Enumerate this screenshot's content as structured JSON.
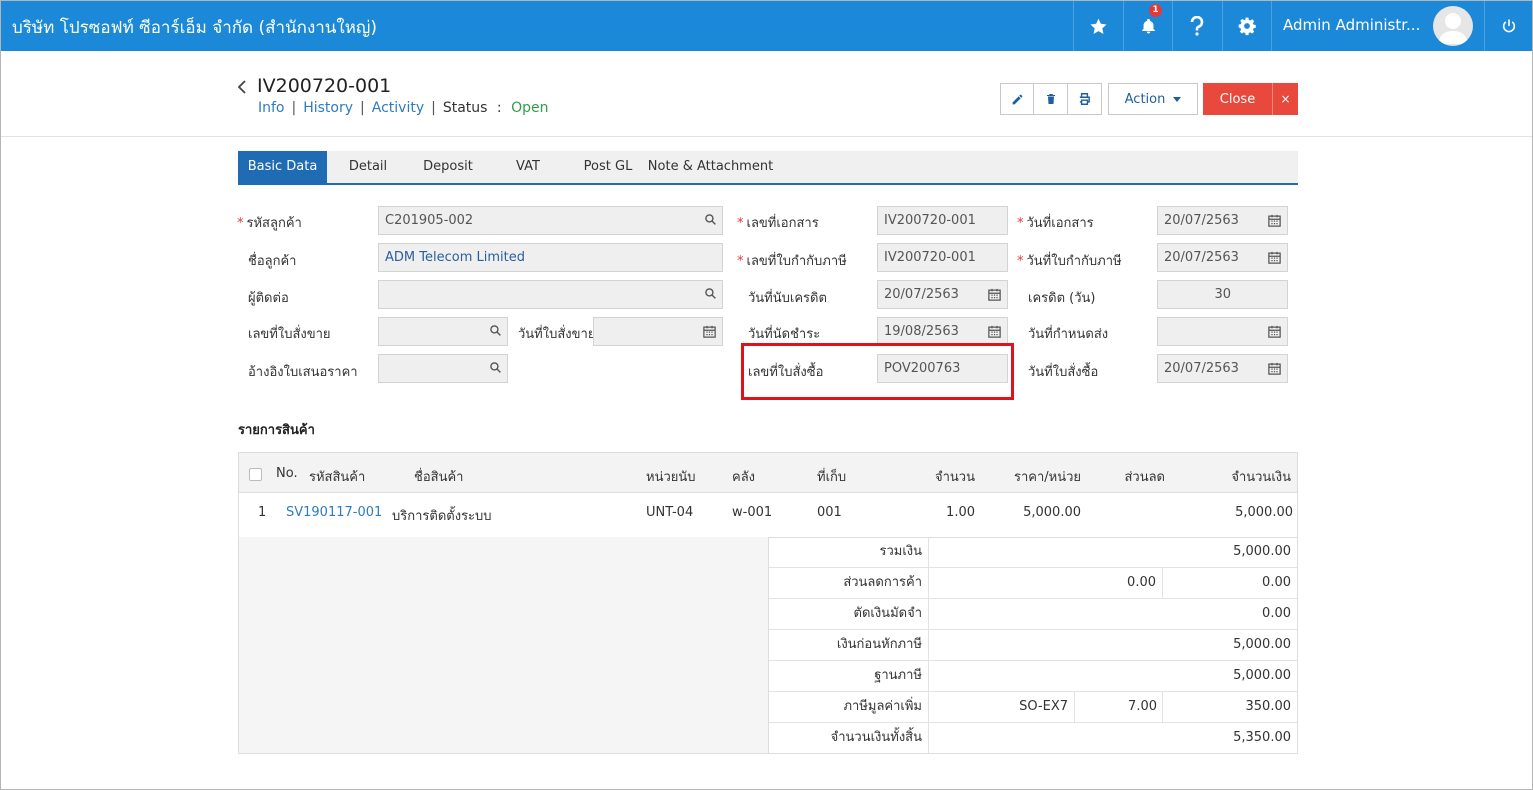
{
  "header": {
    "company": "บริษัท โปรซอฟท์ ซีอาร์เอ็ม จำกัด (สำนักงานใหญ่)",
    "notification_count": "1",
    "user_name": "Admin Administr...",
    "icons": [
      "star-icon",
      "bell-icon",
      "help-icon",
      "gear-icon",
      "avatar",
      "power-icon"
    ]
  },
  "document": {
    "number": "IV200720-001",
    "nav": {
      "info": "Info",
      "history": "History",
      "activity": "Activity",
      "status_label": "Status",
      "status_colon": ":",
      "status_value": "Open"
    },
    "buttons": {
      "action": "Action",
      "close": "Close",
      "close_x": "×"
    }
  },
  "tabs": [
    "Basic Data",
    "Detail",
    "Deposit",
    "VAT",
    "Post GL",
    "Note & Attachment"
  ],
  "form": {
    "customer_code": {
      "label": "รหัสลูกค้า",
      "value": "C201905-002"
    },
    "customer_name": {
      "label": "ชื่อลูกค้า",
      "value": "ADM Telecom Limited"
    },
    "contact": {
      "label": "ผู้ติดต่อ",
      "value": ""
    },
    "sales_order_no": {
      "label": "เลขที่ใบสั่งขาย",
      "value": ""
    },
    "sales_order_date": {
      "label": "วันที่ใบสั่งขาย",
      "value": ""
    },
    "quotation_ref": {
      "label": "อ้างอิงใบเสนอราคา",
      "value": ""
    },
    "doc_no": {
      "label": "เลขที่เอกสาร",
      "value": "IV200720-001"
    },
    "tax_invoice_no": {
      "label": "เลขที่ใบกำกับภาษี",
      "value": "IV200720-001"
    },
    "credit_start_date": {
      "label": "วันที่นับเครดิต",
      "value": "20/07/2563"
    },
    "due_date": {
      "label": "วันที่นัดชำระ",
      "value": "19/08/2563"
    },
    "po_no": {
      "label": "เลขที่ใบสั่งซื้อ",
      "value": "POV200763"
    },
    "doc_date": {
      "label": "วันที่เอกสาร",
      "value": "20/07/2563"
    },
    "tax_invoice_date": {
      "label": "วันที่ใบกำกับภาษี",
      "value": "20/07/2563"
    },
    "credit_days": {
      "label": "เครดิต (วัน)",
      "value": "30"
    },
    "delivery_date": {
      "label": "วันที่กำหนดส่ง",
      "value": ""
    },
    "po_date": {
      "label": "วันที่ใบสั่งซื้อ",
      "value": "20/07/2563"
    }
  },
  "items": {
    "title": "รายการสินค้า",
    "columns": {
      "no": "No.",
      "code": "รหัสสินค้า",
      "name": "ชื่อสินค้า",
      "unit": "หน่วยนับ",
      "warehouse": "คลัง",
      "location": "ที่เก็บ",
      "qty": "จำนวน",
      "price": "ราคา/หน่วย",
      "discount": "ส่วนลด",
      "amount": "จำนวนเงิน"
    },
    "rows": [
      {
        "no": "1",
        "code": "SV190117-001",
        "name": "บริการติดตั้งระบบ",
        "unit": "UNT-04",
        "warehouse": "w-001",
        "location": "001",
        "qty": "1.00",
        "price": "5,000.00",
        "discount": "",
        "amount": "5,000.00"
      }
    ]
  },
  "summary": {
    "total": {
      "label": "รวมเงิน",
      "value": "5,000.00"
    },
    "discount": {
      "label": "ส่วนลดการค้า",
      "percent": "0.00",
      "value": "0.00"
    },
    "deposit": {
      "label": "ตัดเงินมัดจำ",
      "value": "0.00"
    },
    "before_tax": {
      "label": "เงินก่อนหักภาษี",
      "value": "5,000.00"
    },
    "tax_base": {
      "label": "ฐานภาษี",
      "value": "5,000.00"
    },
    "vat": {
      "label": "ภาษีมูลค่าเพิ่ม",
      "code": "SO-EX7",
      "rate": "7.00",
      "value": "350.00"
    },
    "grand_total": {
      "label": "จำนวนเงินทั้งสิ้น",
      "value": "5,350.00"
    }
  }
}
